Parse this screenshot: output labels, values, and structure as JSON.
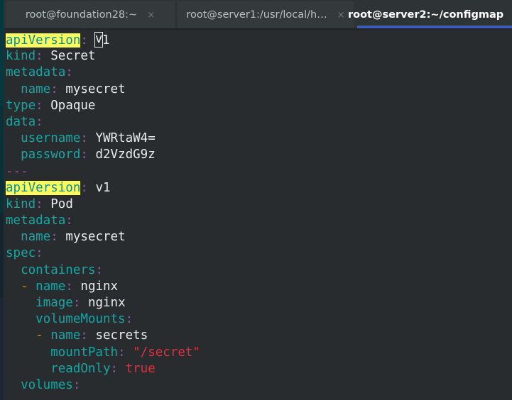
{
  "window": {
    "title": "root@server2:~/configmap",
    "background_color": "#282c2e",
    "tabbar_color": "#2e3436",
    "accent_color": "#3b5bb5"
  },
  "tabbar": {
    "tabs": [
      {
        "label": "root@foundation28:~",
        "close_icon": "×",
        "active": false
      },
      {
        "label": "root@server1:/usr/local/h…",
        "close_icon": "×",
        "active": false
      },
      {
        "label": "root@server2:~/configmap",
        "close_icon": "×",
        "active": true
      }
    ]
  },
  "editor": {
    "cursor_char": "v",
    "lines": [
      {
        "indent": "",
        "key": "apiVersion",
        "colon": ":",
        "value": "1",
        "highlight": true,
        "cursor": true,
        "type": "value"
      },
      {
        "indent": "",
        "key": "kind",
        "colon": ":",
        "value": "Secret",
        "highlight": false,
        "cursor": false,
        "type": "value"
      },
      {
        "indent": "",
        "key": "metadata",
        "colon": ":",
        "value": "",
        "highlight": false,
        "cursor": false,
        "type": "mapping"
      },
      {
        "indent": "  ",
        "key": "name",
        "colon": ":",
        "value": "mysecret",
        "highlight": false,
        "cursor": false,
        "type": "value"
      },
      {
        "indent": "",
        "key": "type",
        "colon": ":",
        "value": "Opaque",
        "highlight": false,
        "cursor": false,
        "type": "value"
      },
      {
        "indent": "",
        "key": "data",
        "colon": ":",
        "value": "",
        "highlight": false,
        "cursor": false,
        "type": "mapping"
      },
      {
        "indent": "  ",
        "key": "username",
        "colon": ":",
        "value": "YWRtaW4=",
        "highlight": false,
        "cursor": false,
        "type": "value"
      },
      {
        "indent": "  ",
        "key": "password",
        "colon": ":",
        "value": "d2VzdG9z",
        "highlight": false,
        "cursor": false,
        "type": "value"
      },
      {
        "indent": "",
        "key": "",
        "colon": "",
        "value": "---",
        "highlight": false,
        "cursor": false,
        "type": "separator"
      },
      {
        "indent": "",
        "key": "apiVersion",
        "colon": ":",
        "value": "v1",
        "highlight": true,
        "cursor": false,
        "type": "value"
      },
      {
        "indent": "",
        "key": "kind",
        "colon": ":",
        "value": "Pod",
        "highlight": false,
        "cursor": false,
        "type": "value"
      },
      {
        "indent": "",
        "key": "metadata",
        "colon": ":",
        "value": "",
        "highlight": false,
        "cursor": false,
        "type": "mapping"
      },
      {
        "indent": "  ",
        "key": "name",
        "colon": ":",
        "value": "mysecret",
        "highlight": false,
        "cursor": false,
        "type": "value"
      },
      {
        "indent": "",
        "key": "spec",
        "colon": ":",
        "value": "",
        "highlight": false,
        "cursor": false,
        "type": "mapping"
      },
      {
        "indent": "  ",
        "key": "containers",
        "colon": ":",
        "value": "",
        "highlight": false,
        "cursor": false,
        "type": "mapping"
      },
      {
        "indent": "  ",
        "dash": "- ",
        "key": "name",
        "colon": ":",
        "value": "nginx",
        "highlight": false,
        "cursor": false,
        "type": "item"
      },
      {
        "indent": "    ",
        "key": "image",
        "colon": ":",
        "value": "nginx",
        "highlight": false,
        "cursor": false,
        "type": "value"
      },
      {
        "indent": "    ",
        "key": "volumeMounts",
        "colon": ":",
        "value": "",
        "highlight": false,
        "cursor": false,
        "type": "mapping"
      },
      {
        "indent": "    ",
        "dash": "- ",
        "key": "name",
        "colon": ":",
        "value": "secrets",
        "highlight": false,
        "cursor": false,
        "type": "item"
      },
      {
        "indent": "      ",
        "key": "mountPath",
        "colon": ":",
        "value": "\"/secret\"",
        "highlight": false,
        "cursor": false,
        "type": "string"
      },
      {
        "indent": "      ",
        "key": "readOnly",
        "colon": ":",
        "value": "true",
        "highlight": false,
        "cursor": false,
        "type": "bool"
      },
      {
        "indent": "  ",
        "key": "volumes",
        "colon": ":",
        "value": "",
        "highlight": false,
        "cursor": false,
        "type": "mapping"
      }
    ]
  },
  "colors": {
    "key": "#15a6a6",
    "colon": "#8b5fa8",
    "value": "#e8eced",
    "string": "#e03040",
    "boolean": "#e03040",
    "dash": "#d98b1e",
    "separator": "#a04ea8",
    "highlight_bg": "#fbfb60",
    "highlight_fg": "#0f8d8d"
  }
}
